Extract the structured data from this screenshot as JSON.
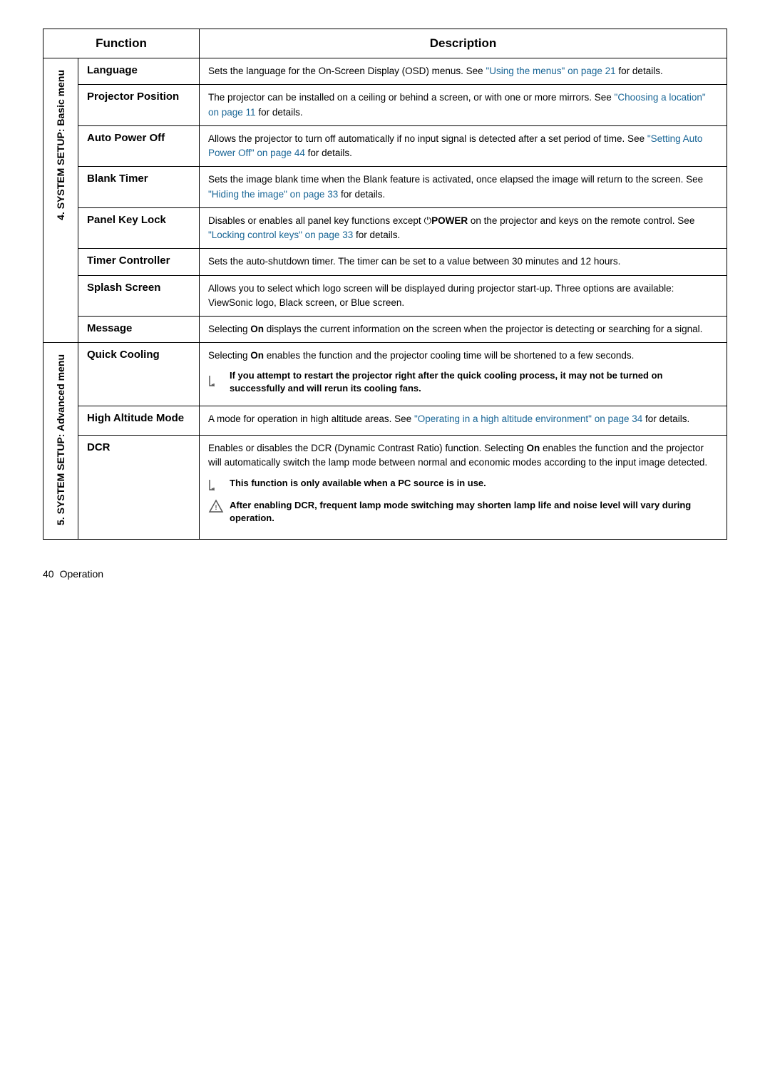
{
  "header": {
    "function_col": "Function",
    "description_col": "Description"
  },
  "sections": [
    {
      "id": "section-4",
      "label": "4. SYSTEM SETUP: Basic menu",
      "rowspan": 8,
      "rows": [
        {
          "function": "Language",
          "description": "Sets the language for the On-Screen Display (OSD) menus. See ",
          "link": "\"Using the menus\" on page 21",
          "description_after": " for details.",
          "has_link": true
        },
        {
          "function": "Projector Position",
          "description": "The projector can be installed on a ceiling or behind a screen, or with one or more mirrors. See ",
          "link": "\"Choosing a location\" on page 11",
          "description_after": " for details.",
          "has_link": true
        },
        {
          "function": "Auto Power Off",
          "description": "Allows the projector to turn off automatically if no input signal is detected after a set period of time. See ",
          "link": "\"Setting Auto Power Off\" on page 44",
          "description_after": " for details.",
          "has_link": true
        },
        {
          "function": "Blank Timer",
          "description": "Sets the image blank time when the Blank feature is activated, once elapsed the image will return to the screen. See ",
          "link": "\"Hiding the image\" on page 33",
          "description_after": " for details.",
          "has_link": true
        },
        {
          "function": "Panel Key Lock",
          "description_parts": [
            {
              "text": "Disables or enables all panel key functions except ",
              "bold": false
            },
            {
              "text": "POWER",
              "bold": true,
              "power_icon": true
            },
            {
              "text": " on the projector and keys on the remote control. See ",
              "bold": false
            },
            {
              "text": "\"Locking control keys\" on page 33",
              "bold": false,
              "link": true
            },
            {
              "text": " for details.",
              "bold": false
            }
          ],
          "type": "parts"
        },
        {
          "function": "Timer Controller",
          "description": "Sets the auto-shutdown timer. The timer can be set to a value between 30 minutes and 12 hours.",
          "has_link": false
        },
        {
          "function": "Splash Screen",
          "description": "Allows you to select which logo screen will be displayed during projector start-up. Three options are available: ViewSonic logo, Black screen, or Blue screen.",
          "has_link": false
        },
        {
          "function": "Message",
          "description_parts": [
            {
              "text": "Selecting ",
              "bold": false
            },
            {
              "text": "On",
              "bold": true
            },
            {
              "text": " displays the current information on the screen when the projector is detecting or searching for a signal.",
              "bold": false
            }
          ],
          "type": "parts"
        }
      ]
    },
    {
      "id": "section-5",
      "label": "5. SYSTEM SETUP: Advanced menu",
      "rowspan": 3,
      "rows": [
        {
          "function": "Quick Cooling",
          "type": "quick_cooling",
          "description_intro_parts": [
            {
              "text": "Selecting ",
              "bold": false
            },
            {
              "text": "On",
              "bold": true
            },
            {
              "text": " enables the function and the projector cooling time will be shortened to a few seconds.",
              "bold": false
            }
          ],
          "note": "If you attempt to restart the projector right after the quick cooling process, it may not be turned on successfully and will rerun its cooling fans."
        },
        {
          "function": "High Altitude Mode",
          "type": "link_row",
          "description": "A mode for operation in high altitude areas. See ",
          "link": "\"Operating in a high altitude environment\" on page 34",
          "description_after": " for details.",
          "has_link": true
        },
        {
          "function": "DCR",
          "type": "dcr",
          "description_parts": [
            {
              "text": "Enables or disables the DCR (Dynamic Contrast Ratio) function. Selecting ",
              "bold": false
            },
            {
              "text": "On",
              "bold": true
            },
            {
              "text": " enables the function and the projector will automatically switch the lamp mode between normal and economic modes according to the input image detected.",
              "bold": false
            }
          ],
          "note1": "This function is only available when a PC source is in use.",
          "note2": "After enabling DCR, frequent lamp mode switching may shorten lamp life and noise level will vary during operation."
        }
      ]
    }
  ],
  "footer": {
    "page_number": "40",
    "label": "Operation"
  }
}
